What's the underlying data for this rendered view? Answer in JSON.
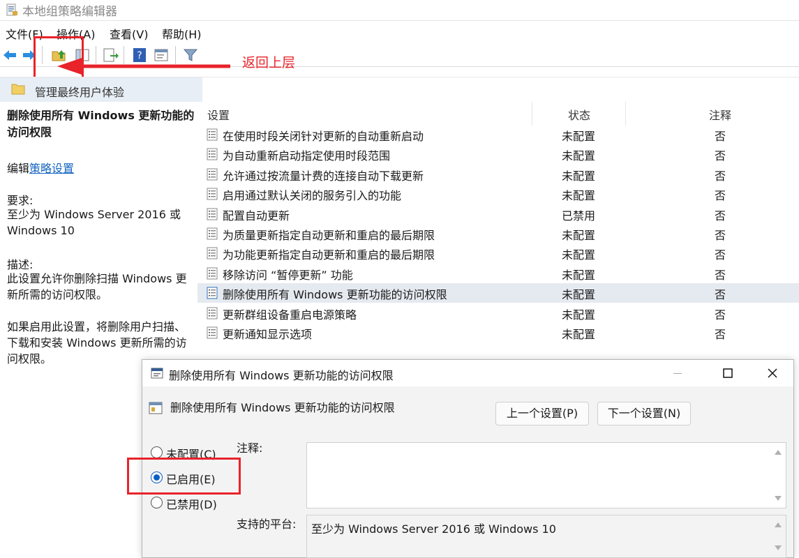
{
  "window": {
    "title": "本地组策略编辑器"
  },
  "menu": {
    "items": [
      "文件(F)",
      "操作(A)",
      "查看(V)",
      "帮助(H)"
    ]
  },
  "annotation": {
    "text": "返回上层",
    "color": "#e8232a"
  },
  "breadcrumb": {
    "text": "管理最终用户体验"
  },
  "description": {
    "title": "删除使用所有 Windows 更新功能的访问权限",
    "edit_prefix": "编辑",
    "edit_link": "策略设置",
    "requirements_label": "要求:",
    "requirements_text": "至少为 Windows Server 2016 或 Windows 10",
    "description_label": "描述:",
    "description_text": "此设置允许你删除扫描 Windows 更新所需的访问权限。",
    "description_text2": "如果启用此设置，将删除用户扫描、下载和安装 Windows 更新所需的访问权限。"
  },
  "list": {
    "columns": [
      "设置",
      "状态",
      "注释"
    ],
    "rows": [
      {
        "name": "在使用时段关闭针对更新的自动重新启动",
        "state": "未配置",
        "comment": "否"
      },
      {
        "name": "为自动重新启动指定使用时段范围",
        "state": "未配置",
        "comment": "否"
      },
      {
        "name": "允许通过按流量计费的连接自动下载更新",
        "state": "未配置",
        "comment": "否"
      },
      {
        "name": "启用通过默认关闭的服务引入的功能",
        "state": "未配置",
        "comment": "否"
      },
      {
        "name": "配置自动更新",
        "state": "已禁用",
        "comment": "否"
      },
      {
        "name": "为质量更新指定自动更新和重启的最后期限",
        "state": "未配置",
        "comment": "否"
      },
      {
        "name": "为功能更新指定自动更新和重启的最后期限",
        "state": "未配置",
        "comment": "否"
      },
      {
        "name": "移除访问 “暂停更新” 功能",
        "state": "未配置",
        "comment": "否"
      },
      {
        "name": "删除使用所有 Windows 更新功能的访问权限",
        "state": "未配置",
        "comment": "否",
        "selected": true
      },
      {
        "name": "更新群组设备重启电源策略",
        "state": "未配置",
        "comment": "否"
      },
      {
        "name": "更新通知显示选项",
        "state": "未配置",
        "comment": "否"
      }
    ]
  },
  "dialog": {
    "title": "删除使用所有 Windows 更新功能的访问权限",
    "heading": "删除使用所有 Windows 更新功能的访问权限",
    "prev_button": "上一个设置(P)",
    "next_button": "下一个设置(N)",
    "options": [
      {
        "label": "未配置(C)",
        "selected": false
      },
      {
        "label": "已启用(E)",
        "selected": true
      },
      {
        "label": "已禁用(D)",
        "selected": false
      }
    ],
    "comment_label": "注释:",
    "comment_value": "",
    "platform_label": "支持的平台:",
    "platform_value": "至少为 Windows Server 2016 或 Windows 10"
  }
}
